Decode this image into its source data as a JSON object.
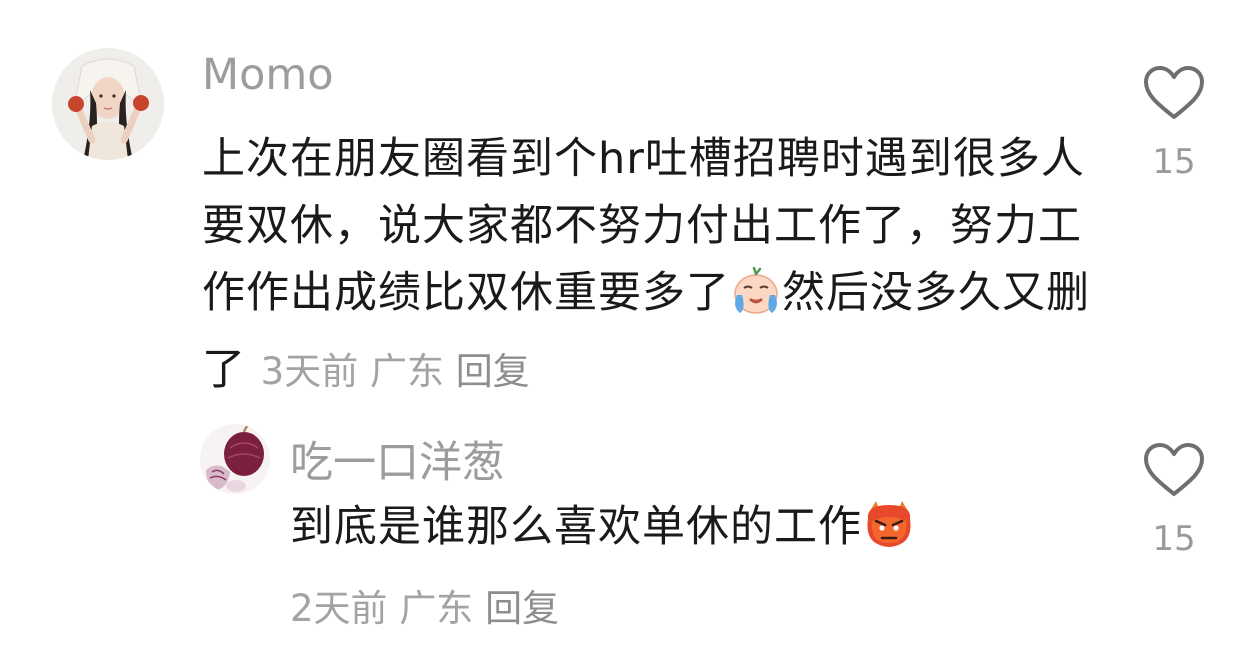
{
  "comments": [
    {
      "username": "Momo",
      "text": "上次在朋友圈看到个hr吐槽招聘时遇到很多人要双休，说大家都不努力付出工作了，努力工作作出成绩比双休重要多了",
      "text_after_emoji": "然后没多久又删了",
      "emoji": "crying-face-emoji",
      "time": "3天前",
      "location": "广东",
      "reply_label": "回复",
      "likes": "15"
    },
    {
      "username": "吃一口洋葱",
      "text": "到底是谁那么喜欢单休的工作",
      "emoji": "angry-devil-emoji",
      "time": "2天前",
      "location": "广东",
      "reply_label": "回复",
      "likes": "15"
    }
  ],
  "icons": {
    "like": "heart-outline-icon"
  },
  "colors": {
    "username": "#9c9c9c",
    "text": "#1a1a1a",
    "meta": "#a3a3a3",
    "heart_stroke": "#6f6f6f"
  }
}
